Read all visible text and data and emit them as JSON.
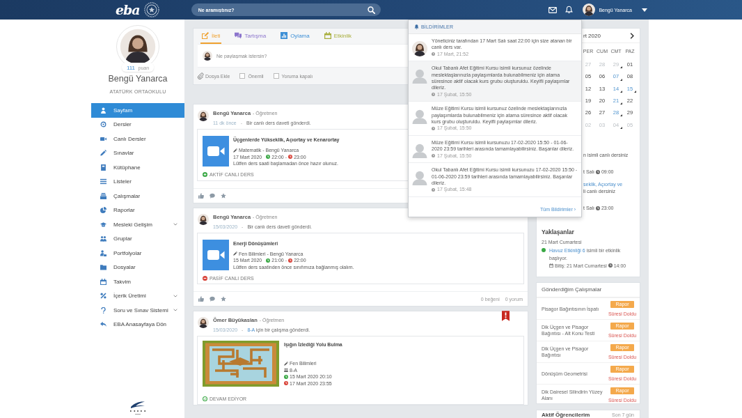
{
  "topbar": {
    "logo": "eba",
    "search": {
      "placeholder": "Ne aramıştınız?"
    },
    "user": {
      "name": "Bengü Yanarca"
    }
  },
  "profile": {
    "points": "111",
    "points_unit": "puan",
    "name": "Bengü Yanarca",
    "school": "ATATÜRK ORTAOKULU"
  },
  "menu": [
    {
      "label": "Sayfam",
      "selected": true,
      "submenu": false
    },
    {
      "label": "Dersler",
      "selected": false,
      "submenu": false
    },
    {
      "label": "Canlı Dersler",
      "selected": false,
      "submenu": false
    },
    {
      "label": "Sınavlar",
      "selected": false,
      "submenu": false
    },
    {
      "label": "Kütüphane",
      "selected": false,
      "submenu": false
    },
    {
      "label": "Listeler",
      "selected": false,
      "submenu": false
    },
    {
      "label": "Çalışmalar",
      "selected": false,
      "submenu": false
    },
    {
      "label": "Raporlar",
      "selected": false,
      "submenu": false
    },
    {
      "label": "Mesleki Gelişim",
      "selected": false,
      "submenu": true
    },
    {
      "label": "Gruplar",
      "selected": false,
      "submenu": false
    },
    {
      "label": "Portfolyolar",
      "selected": false,
      "submenu": false
    },
    {
      "label": "Dosyalar",
      "selected": false,
      "submenu": false
    },
    {
      "label": "Takvim",
      "selected": false,
      "submenu": false
    },
    {
      "label": "İçerik Üretimi",
      "selected": false,
      "submenu": true
    },
    {
      "label": "Soru ve Sınav Sistemi",
      "selected": false,
      "submenu": true
    },
    {
      "label": "EBA Anasayfaya Dön",
      "selected": false,
      "submenu": false
    }
  ],
  "composer": {
    "tabs": [
      {
        "label": "İleti",
        "color": "#f0a12f",
        "selected": true
      },
      {
        "label": "Tartışma",
        "color": "#8b74cc",
        "selected": false
      },
      {
        "label": "Oylama",
        "color": "#3d8fd6",
        "selected": false
      },
      {
        "label": "Etkinlik",
        "color": "#a8ae3c",
        "selected": false
      }
    ],
    "placeholder": "Ne paylaşmak istersin?",
    "attach": "Dosya Ekle",
    "options": [
      {
        "label": "Önemli",
        "checked": false
      },
      {
        "label": "Yoruma kapalı",
        "checked": false
      }
    ]
  },
  "posts": [
    {
      "kind": "live",
      "author": "Bengü Yanarca",
      "role": "- Öğretmen",
      "time": "11 dk önce",
      "separator": "-",
      "action": "Bir canlı ders daveti gönderdi.",
      "important": false,
      "attachment": {
        "title": "Üçgenlerde Yükseklik, Açıortay ve Kenarortay",
        "subject": "Matematik - Bengü Yanarca",
        "date": "17 Mart 2020",
        "start": "22:00",
        "dash": "-",
        "end": "23:00",
        "note": "Lütfen ders saati başlamadan önce hazır olunuz."
      },
      "status": {
        "kind": "active",
        "text": "AKTİF CANLI DERS"
      },
      "footer": true
    },
    {
      "kind": "live",
      "author": "Bengü Yanarca",
      "role": "- Öğretmen",
      "time": "15/03/2020",
      "separator": "-",
      "action": "Bir canlı ders daveti gönderdi.",
      "important": false,
      "attachment": {
        "title": "Enerji Dönüşümleri",
        "subject": "Fen Bilimleri - Bengü Yanarca",
        "date": "15 Mart 2020",
        "start": "21:00",
        "dash": "-",
        "end": "22:00",
        "note": "Lütfen ders saatinden önce sınıfımıza bağlanmış olalım."
      },
      "status": {
        "kind": "passive",
        "text": "PASİF CANLI DERS"
      },
      "footer": true,
      "counts": [
        "0 beğeni",
        "0 yorum"
      ]
    },
    {
      "kind": "assignment",
      "author": "Ömer Büyükaslan",
      "role": "- Öğretmen",
      "time": "15/03/2020",
      "separator": "-",
      "action_link": "8-A",
      "action": "için bir çalışma gönderdi.",
      "important": true,
      "attachment": {
        "title": "Işığın İzlediği Yolu Bulma",
        "subject": "Fen Bilimleri",
        "group": "8-A",
        "start": "15 Mart 2020 20:10",
        "end": "17 Mart 2020 23:55"
      },
      "status": {
        "kind": "ongoing",
        "text": "DEVAM EDİYOR"
      },
      "footer": false
    }
  ],
  "notifications": {
    "title": "BİLDİRİMLER",
    "items": [
      {
        "kind": "photo",
        "text": "Yöneticiniz tarafından 17 Mart Salı saat 22:00 için size atanan bir canlı ders var.",
        "time": "17 Mart, 21:52",
        "hovered": false
      },
      {
        "kind": "default",
        "text": "Okul Tabanlı Afet Eğitimi Kursu isimli kursunuz özelinde meslektaşlarınızla paylaşımlarda bulunabilmeniz için atama süresince aktif olacak kurs grubu oluşturuldu. Keyifli paylaşımlar dileriz.",
        "time": "17 Şubat, 15:50",
        "hovered": true
      },
      {
        "kind": "default",
        "text": "Müze Eğitimi Kursu isimli kursunuz özelinde meslektaşlarınızla paylaşımlarda bulunabilmeniz için atama süresince aktif olacak kurs grubu oluşturuldu. Keyifli paylaşımlar dileriz.",
        "time": "17 Şubat, 15:50",
        "hovered": false
      },
      {
        "kind": "default",
        "text": "Müze Eğitimi Kursu isimli kursunuzu 17-02-2020 15:50 - 01-06-2020 23:59 tarihleri arasında tamamlayabilirsiniz. Başarılar dileriz.",
        "time": "17 Şubat, 15:50",
        "hovered": false
      },
      {
        "kind": "default",
        "text": "Okul Tabanlı Afet Eğitimi Kursu isimli kursunuzu 17-02-2020 15:50 - 01-06-2020 23:59 tarihleri arasında tamamlayabilirsiniz. Başarılar dileriz.",
        "time": "17 Şubat, 15:48",
        "hovered": false
      }
    ],
    "all_link": "Tüm Bildirimler ›"
  },
  "calendar": {
    "month": "rt 2020",
    "weekdays": [
      "PER",
      "CUM",
      "CMT",
      "PAZ"
    ],
    "weeks": [
      [
        {
          "day": "27",
          "muted": true,
          "event": false
        },
        {
          "day": "28",
          "muted": true,
          "event": false
        },
        {
          "day": "29",
          "muted": true,
          "event": true
        },
        {
          "day": "01",
          "muted": false,
          "event": false
        }
      ],
      [
        {
          "day": "05",
          "muted": false,
          "event": false
        },
        {
          "day": "06",
          "muted": false,
          "event": false
        },
        {
          "day": "07",
          "muted": false,
          "event": true
        },
        {
          "day": "08",
          "muted": false,
          "event": false
        }
      ],
      [
        {
          "day": "12",
          "muted": false,
          "event": false
        },
        {
          "day": "13",
          "muted": false,
          "event": false
        },
        {
          "day": "14",
          "muted": false,
          "event": true
        },
        {
          "day": "15",
          "muted": false,
          "event": true
        }
      ],
      [
        {
          "day": "19",
          "muted": false,
          "event": false
        },
        {
          "day": "20",
          "muted": false,
          "event": false
        },
        {
          "day": "21",
          "muted": false,
          "event": true
        },
        {
          "day": "22",
          "muted": false,
          "event": false
        }
      ],
      [
        {
          "day": "26",
          "muted": false,
          "event": false
        },
        {
          "day": "27",
          "muted": false,
          "event": false
        },
        {
          "day": "28",
          "muted": false,
          "event": true
        },
        {
          "day": "29",
          "muted": false,
          "event": false
        }
      ],
      [
        {
          "day": "02",
          "muted": true,
          "event": false
        },
        {
          "day": "03",
          "muted": true,
          "event": false
        },
        {
          "day": "04",
          "muted": true,
          "event": true
        },
        {
          "day": "05",
          "muted": true,
          "event": false
        }
      ]
    ]
  },
  "live_classes": [
    {
      "lines": [
        "n isimli canlı dersiniz"
      ],
      "day": "t Salı",
      "time": "09:00"
    },
    {
      "link": "seklik, Açıortay ve",
      "lines": [
        "li canlı dersiniz"
      ],
      "day": "t Salı",
      "time": "23:00"
    }
  ],
  "upcoming": {
    "title": "Yaklaşanlar",
    "date": "21 Mart Cumartesi",
    "items": [
      {
        "color": "#3aa845",
        "link": "Havuz Etkinliği 6",
        "text": "isimli bir etkinlik başlıyor.",
        "end": "Bitiş: 21 Mart Cumartesi",
        "end_time": "14:00"
      }
    ]
  },
  "works": {
    "title": "Gönderdiğim Çalışmalar",
    "items": [
      {
        "name": "Pisagor Bağıntısının İspatı",
        "action": "Rapor",
        "status": "Süresi Doldu"
      },
      {
        "name": "Dik Üçgen ve Pisagor Bağıntısı - Alt Konu Testi",
        "action": "Rapor",
        "status": "Süresi Doldu"
      },
      {
        "name": "Dik Üçgen ve Pisagor Bağıntısı",
        "action": "Rapor",
        "status": "Süresi Doldu"
      },
      {
        "name": "Dönüşüm Geometrisi",
        "action": "Rapor",
        "status": "Süresi Doldu"
      },
      {
        "name": "Dik Dairesel Silindirin Yüzey Alanı",
        "action": "Rapor",
        "status": "Süresi Doldu"
      }
    ]
  },
  "active_students": {
    "title": "Aktif Öğrencilerim",
    "period": "Son 7 gün"
  }
}
